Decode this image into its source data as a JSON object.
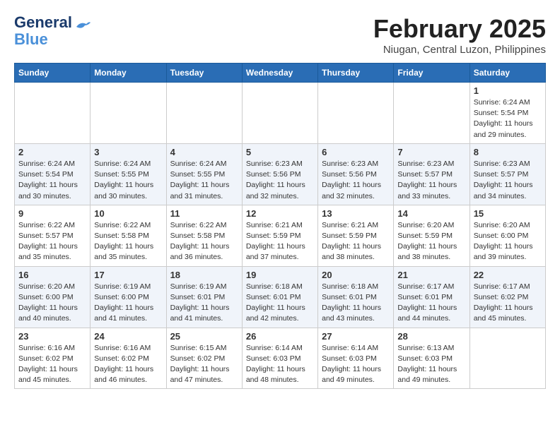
{
  "header": {
    "logo_line1": "General",
    "logo_line2": "Blue",
    "month_year": "February 2025",
    "location": "Niugan, Central Luzon, Philippines"
  },
  "weekdays": [
    "Sunday",
    "Monday",
    "Tuesday",
    "Wednesday",
    "Thursday",
    "Friday",
    "Saturday"
  ],
  "weeks": [
    [
      {
        "day": "",
        "info": ""
      },
      {
        "day": "",
        "info": ""
      },
      {
        "day": "",
        "info": ""
      },
      {
        "day": "",
        "info": ""
      },
      {
        "day": "",
        "info": ""
      },
      {
        "day": "",
        "info": ""
      },
      {
        "day": "1",
        "info": "Sunrise: 6:24 AM\nSunset: 5:54 PM\nDaylight: 11 hours\nand 29 minutes."
      }
    ],
    [
      {
        "day": "2",
        "info": "Sunrise: 6:24 AM\nSunset: 5:54 PM\nDaylight: 11 hours\nand 30 minutes."
      },
      {
        "day": "3",
        "info": "Sunrise: 6:24 AM\nSunset: 5:55 PM\nDaylight: 11 hours\nand 30 minutes."
      },
      {
        "day": "4",
        "info": "Sunrise: 6:24 AM\nSunset: 5:55 PM\nDaylight: 11 hours\nand 31 minutes."
      },
      {
        "day": "5",
        "info": "Sunrise: 6:23 AM\nSunset: 5:56 PM\nDaylight: 11 hours\nand 32 minutes."
      },
      {
        "day": "6",
        "info": "Sunrise: 6:23 AM\nSunset: 5:56 PM\nDaylight: 11 hours\nand 32 minutes."
      },
      {
        "day": "7",
        "info": "Sunrise: 6:23 AM\nSunset: 5:57 PM\nDaylight: 11 hours\nand 33 minutes."
      },
      {
        "day": "8",
        "info": "Sunrise: 6:23 AM\nSunset: 5:57 PM\nDaylight: 11 hours\nand 34 minutes."
      }
    ],
    [
      {
        "day": "9",
        "info": "Sunrise: 6:22 AM\nSunset: 5:57 PM\nDaylight: 11 hours\nand 35 minutes."
      },
      {
        "day": "10",
        "info": "Sunrise: 6:22 AM\nSunset: 5:58 PM\nDaylight: 11 hours\nand 35 minutes."
      },
      {
        "day": "11",
        "info": "Sunrise: 6:22 AM\nSunset: 5:58 PM\nDaylight: 11 hours\nand 36 minutes."
      },
      {
        "day": "12",
        "info": "Sunrise: 6:21 AM\nSunset: 5:59 PM\nDaylight: 11 hours\nand 37 minutes."
      },
      {
        "day": "13",
        "info": "Sunrise: 6:21 AM\nSunset: 5:59 PM\nDaylight: 11 hours\nand 38 minutes."
      },
      {
        "day": "14",
        "info": "Sunrise: 6:20 AM\nSunset: 5:59 PM\nDaylight: 11 hours\nand 38 minutes."
      },
      {
        "day": "15",
        "info": "Sunrise: 6:20 AM\nSunset: 6:00 PM\nDaylight: 11 hours\nand 39 minutes."
      }
    ],
    [
      {
        "day": "16",
        "info": "Sunrise: 6:20 AM\nSunset: 6:00 PM\nDaylight: 11 hours\nand 40 minutes."
      },
      {
        "day": "17",
        "info": "Sunrise: 6:19 AM\nSunset: 6:00 PM\nDaylight: 11 hours\nand 41 minutes."
      },
      {
        "day": "18",
        "info": "Sunrise: 6:19 AM\nSunset: 6:01 PM\nDaylight: 11 hours\nand 41 minutes."
      },
      {
        "day": "19",
        "info": "Sunrise: 6:18 AM\nSunset: 6:01 PM\nDaylight: 11 hours\nand 42 minutes."
      },
      {
        "day": "20",
        "info": "Sunrise: 6:18 AM\nSunset: 6:01 PM\nDaylight: 11 hours\nand 43 minutes."
      },
      {
        "day": "21",
        "info": "Sunrise: 6:17 AM\nSunset: 6:01 PM\nDaylight: 11 hours\nand 44 minutes."
      },
      {
        "day": "22",
        "info": "Sunrise: 6:17 AM\nSunset: 6:02 PM\nDaylight: 11 hours\nand 45 minutes."
      }
    ],
    [
      {
        "day": "23",
        "info": "Sunrise: 6:16 AM\nSunset: 6:02 PM\nDaylight: 11 hours\nand 45 minutes."
      },
      {
        "day": "24",
        "info": "Sunrise: 6:16 AM\nSunset: 6:02 PM\nDaylight: 11 hours\nand 46 minutes."
      },
      {
        "day": "25",
        "info": "Sunrise: 6:15 AM\nSunset: 6:02 PM\nDaylight: 11 hours\nand 47 minutes."
      },
      {
        "day": "26",
        "info": "Sunrise: 6:14 AM\nSunset: 6:03 PM\nDaylight: 11 hours\nand 48 minutes."
      },
      {
        "day": "27",
        "info": "Sunrise: 6:14 AM\nSunset: 6:03 PM\nDaylight: 11 hours\nand 49 minutes."
      },
      {
        "day": "28",
        "info": "Sunrise: 6:13 AM\nSunset: 6:03 PM\nDaylight: 11 hours\nand 49 minutes."
      },
      {
        "day": "",
        "info": ""
      }
    ]
  ]
}
